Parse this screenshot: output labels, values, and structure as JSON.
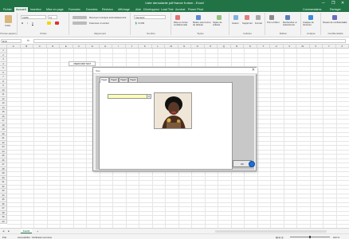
{
  "window": {
    "title": "Liste deroulante pdf france fr.xlsm - Excel",
    "minimize": "─",
    "restore": "❐",
    "close": "✕"
  },
  "ribbon_tabs": [
    "Fichier",
    "Accueil",
    "Insertion",
    "Mise en page",
    "Formules",
    "Données",
    "Révision",
    "Affichage",
    "Aide",
    "Développeur",
    "Load Test",
    "Acrobat",
    "Power Pivot"
  ],
  "ribbon_tabs_right": {
    "comments": "Commentaires",
    "share": "Partager"
  },
  "ribbon": {
    "clipboard": {
      "label": "Presse-papiers",
      "paste": "Coller"
    },
    "font": {
      "label": "Police",
      "name": "Calibri",
      "size": "11"
    },
    "alignment": {
      "label": "Alignement",
      "wrap": "Renvoyer à la ligne automatiquement",
      "merge": "Fusionner et centrer"
    },
    "number": {
      "label": "Nombre",
      "format": "Standard"
    },
    "styles": {
      "label": "Styles",
      "conditional": "Mise en forme conditionnelle",
      "table": "Mettre sous forme de tableau",
      "cell": "Styles de cellules"
    },
    "cells": {
      "label": "Cellules",
      "insert": "Insérer",
      "delete": "Supprimer",
      "format": "Format"
    },
    "editing": {
      "label": "Édition",
      "sort": "Trier et filtrer",
      "find": "Rechercher et sélectionner"
    },
    "analysis": {
      "label": "Analyse",
      "analyze": "Analyse de données"
    },
    "sensitivity": {
      "label": "Confidentialité",
      "value": "Niveau de confidentialité"
    }
  },
  "formula_bar": {
    "name_box": "D19",
    "fx": "fx",
    "value": ""
  },
  "columns": [
    "A",
    "B",
    "C",
    "D",
    "E",
    "F",
    "G",
    "H",
    "I",
    "J",
    "K",
    "L",
    "M",
    "N",
    "O",
    "P",
    "Q",
    "R",
    "S",
    "T",
    "U",
    "V",
    "W",
    "X",
    "Y",
    "Z",
    "AA"
  ],
  "rows": [
    "1",
    "2",
    "3",
    "4",
    "5",
    "6",
    "7",
    "8",
    "9",
    "10",
    "11",
    "12",
    "13",
    "14",
    "15",
    "16",
    "17",
    "18",
    "19",
    "20",
    "21",
    "22",
    "23",
    "24",
    "25",
    "26",
    "27",
    "28",
    "29",
    "30",
    "31",
    "32",
    "33",
    "34",
    "35",
    "36",
    "37",
    "38",
    "39",
    "40"
  ],
  "sheet_button": "USERFORM TEST",
  "dialog": {
    "title": "Test",
    "close": "✕",
    "tabs": [
      "Page1",
      "Page2",
      "Page3",
      "Page4"
    ],
    "combo_value": "",
    "combo_arrow": "▾",
    "ok_label": "OK"
  },
  "sheet_tabs": {
    "active": "Feuil1",
    "add": "+"
  },
  "status": {
    "left": "Prêt",
    "accessibility": "Accessibilité : Vérification terminée",
    "zoom": "100 %"
  },
  "colors": {
    "excel_green": "#217346",
    "combo_bg": "#fdfdb8"
  }
}
